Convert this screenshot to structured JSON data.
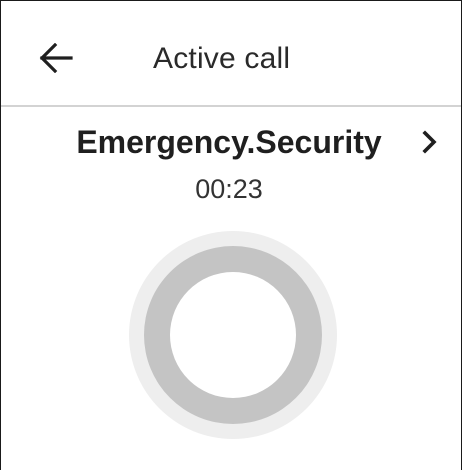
{
  "header": {
    "title": "Active call",
    "back_icon": "arrow-left-icon"
  },
  "call": {
    "callee": "Emergency.Security",
    "duration": "00:23",
    "details_icon": "chevron-right-icon",
    "indicator_icon": "call-status-ring-icon"
  },
  "colors": {
    "background": "#ffffff",
    "divider": "#d3d3d3",
    "ring_outer": "#eeeeee",
    "ring_main": "#c4c4c4",
    "ring_inner": "#ffffff",
    "text": "#1f1f1f"
  }
}
